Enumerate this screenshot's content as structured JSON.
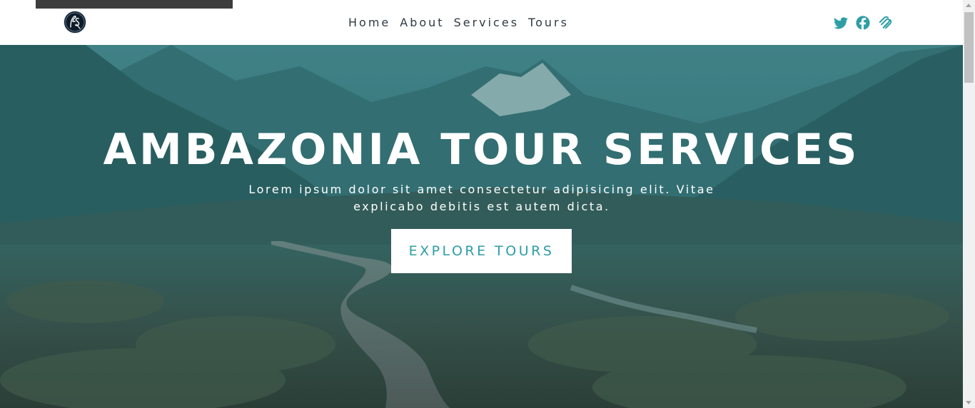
{
  "colors": {
    "accent": "#2d9ea6",
    "nav_text": "#2f3a44",
    "hero_overlay": "#2b7c82",
    "top_strip": "#3d3d3d"
  },
  "brand": {
    "logo_icon": "fs-monogram-logo"
  },
  "nav": {
    "items": [
      {
        "label": "Home"
      },
      {
        "label": "About"
      },
      {
        "label": "Services"
      },
      {
        "label": "Tours"
      }
    ]
  },
  "socials": [
    {
      "icon": "twitter-icon"
    },
    {
      "icon": "facebook-icon"
    },
    {
      "icon": "squarespace-icon"
    }
  ],
  "hero": {
    "title": "AMBAZONIA TOUR SERVICES",
    "subtitle_line1": "Lorem ipsum dolor sit amet consectetur adipisicing elit. Vitae",
    "subtitle_line2": "explicabo debitis est autem dicta.",
    "cta_label": "EXPLORE TOURS"
  }
}
